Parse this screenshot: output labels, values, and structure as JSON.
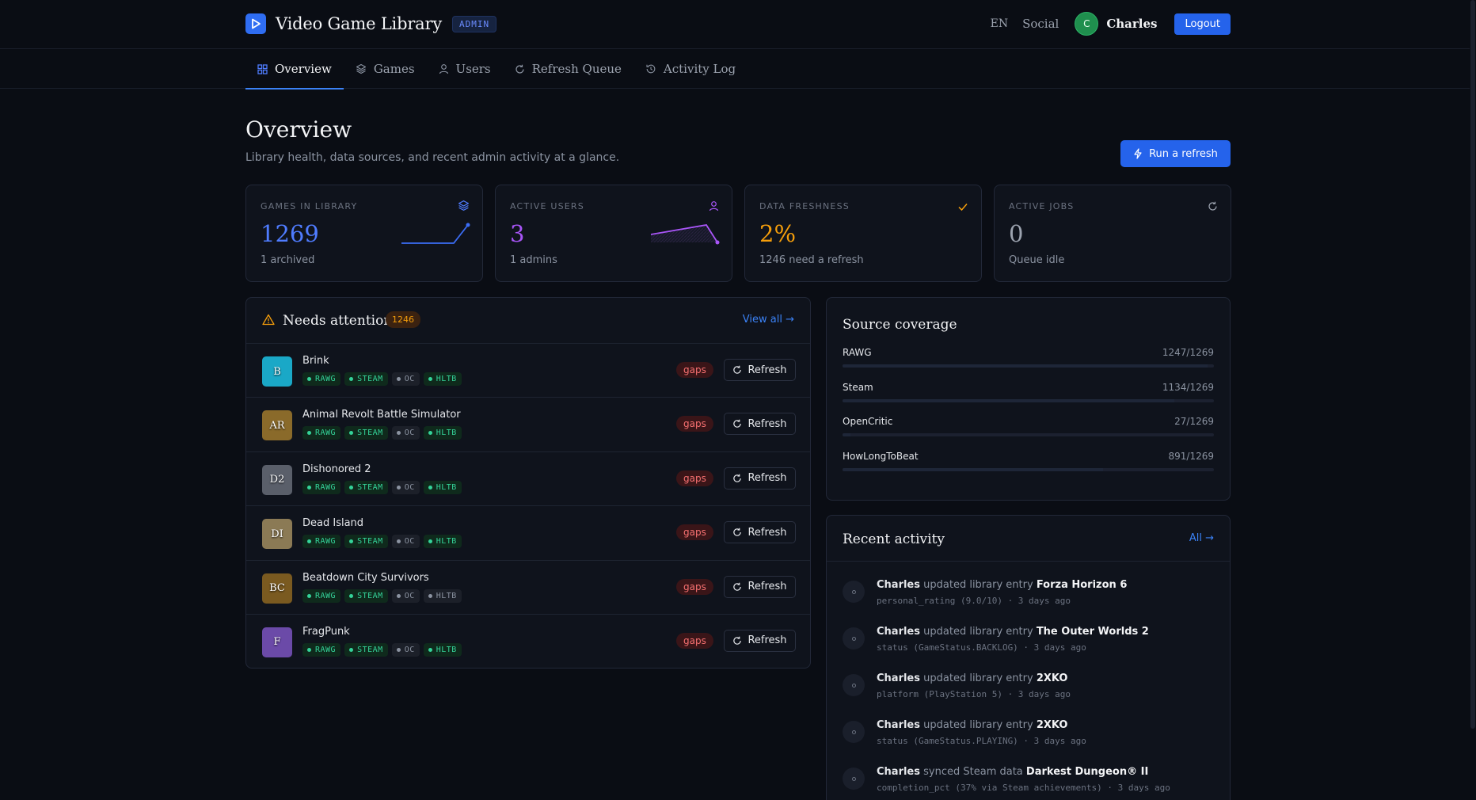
{
  "header": {
    "app_title": "Video Game Library",
    "badge": "ADMIN",
    "lang": "EN",
    "social": "Social",
    "user_initial": "C",
    "username": "Charles",
    "logout": "Logout"
  },
  "tabs": [
    {
      "label": "Overview",
      "icon": "grid-icon",
      "active": true
    },
    {
      "label": "Games",
      "icon": "layers-icon",
      "active": false
    },
    {
      "label": "Users",
      "icon": "user-icon",
      "active": false
    },
    {
      "label": "Refresh Queue",
      "icon": "refresh-icon",
      "active": false
    },
    {
      "label": "Activity Log",
      "icon": "history-icon",
      "active": false
    }
  ],
  "page": {
    "title": "Overview",
    "subtitle": "Library health, data sources, and recent admin activity at a glance.",
    "run_button": "Run a refresh"
  },
  "stats": [
    {
      "label": "GAMES IN LIBRARY",
      "value": "1269",
      "note": "1 archived",
      "color": "#4f7cff",
      "icon": "layers-icon"
    },
    {
      "label": "ACTIVE USERS",
      "value": "3",
      "note": "1 admins",
      "color": "#a855f7",
      "icon": "user-icon"
    },
    {
      "label": "DATA FRESHNESS",
      "value": "2%",
      "note": "1246 need a refresh",
      "color": "#f59e0b",
      "icon": "check-icon"
    },
    {
      "label": "ACTIVE JOBS",
      "value": "0",
      "note": "Queue idle",
      "color": "#9ca3af",
      "icon": "refresh-icon"
    }
  ],
  "attention": {
    "title": "Needs attention",
    "count": "1246",
    "view_all": "View all →",
    "gaps_label": "gaps",
    "refresh_label": "Refresh",
    "games": [
      {
        "name": "Brink",
        "initials": "B",
        "thumb_color": "#1aa8c7",
        "tags": [
          {
            "label": "RAWG",
            "ok": true
          },
          {
            "label": "STEAM",
            "ok": true
          },
          {
            "label": "OC",
            "ok": false
          },
          {
            "label": "HLTB",
            "ok": true
          }
        ]
      },
      {
        "name": "Animal Revolt Battle Simulator",
        "initials": "AR",
        "thumb_color": "#8a6a2a",
        "tags": [
          {
            "label": "RAWG",
            "ok": true
          },
          {
            "label": "STEAM",
            "ok": true
          },
          {
            "label": "OC",
            "ok": false
          },
          {
            "label": "HLTB",
            "ok": true
          }
        ]
      },
      {
        "name": "Dishonored 2",
        "initials": "D2",
        "thumb_color": "#5a5f6a",
        "tags": [
          {
            "label": "RAWG",
            "ok": true
          },
          {
            "label": "STEAM",
            "ok": true
          },
          {
            "label": "OC",
            "ok": false
          },
          {
            "label": "HLTB",
            "ok": true
          }
        ]
      },
      {
        "name": "Dead Island",
        "initials": "DI",
        "thumb_color": "#8b7a55",
        "tags": [
          {
            "label": "RAWG",
            "ok": true
          },
          {
            "label": "STEAM",
            "ok": true
          },
          {
            "label": "OC",
            "ok": false
          },
          {
            "label": "HLTB",
            "ok": true
          }
        ]
      },
      {
        "name": "Beatdown City Survivors",
        "initials": "BC",
        "thumb_color": "#7a5a20",
        "tags": [
          {
            "label": "RAWG",
            "ok": true
          },
          {
            "label": "STEAM",
            "ok": true
          },
          {
            "label": "OC",
            "ok": false
          },
          {
            "label": "HLTB",
            "ok": false
          }
        ]
      },
      {
        "name": "FragPunk",
        "initials": "F",
        "thumb_color": "#6b4aa8",
        "tags": [
          {
            "label": "RAWG",
            "ok": true
          },
          {
            "label": "STEAM",
            "ok": true
          },
          {
            "label": "OC",
            "ok": false
          },
          {
            "label": "HLTB",
            "ok": true
          }
        ]
      }
    ]
  },
  "coverage": {
    "title": "Source coverage",
    "sources": [
      {
        "name": "RAWG",
        "value": "1247/1269",
        "fraction": 0.983
      },
      {
        "name": "Steam",
        "value": "1134/1269",
        "fraction": 0.894
      },
      {
        "name": "OpenCritic",
        "value": "27/1269",
        "fraction": 0.021
      },
      {
        "name": "HowLongToBeat",
        "value": "891/1269",
        "fraction": 0.702
      }
    ]
  },
  "activity": {
    "title": "Recent activity",
    "all_link": "All →",
    "items": [
      {
        "actor": "Charles",
        "action": "updated library entry",
        "target": "Forza Horizon 6",
        "detail": "personal_rating (9.0/10) · 3 days ago"
      },
      {
        "actor": "Charles",
        "action": "updated library entry",
        "target": "The Outer Worlds 2",
        "detail": "status (GameStatus.BACKLOG) · 3 days ago"
      },
      {
        "actor": "Charles",
        "action": "updated library entry",
        "target": "2XKO",
        "detail": "platform (PlayStation 5) · 3 days ago"
      },
      {
        "actor": "Charles",
        "action": "updated library entry",
        "target": "2XKO",
        "detail": "status (GameStatus.PLAYING) · 3 days ago"
      },
      {
        "actor": "Charles",
        "action": "synced Steam data",
        "target": "Darkest Dungeon® II",
        "detail": "completion_pct (37% via Steam achievements) · 3 days ago"
      }
    ]
  }
}
